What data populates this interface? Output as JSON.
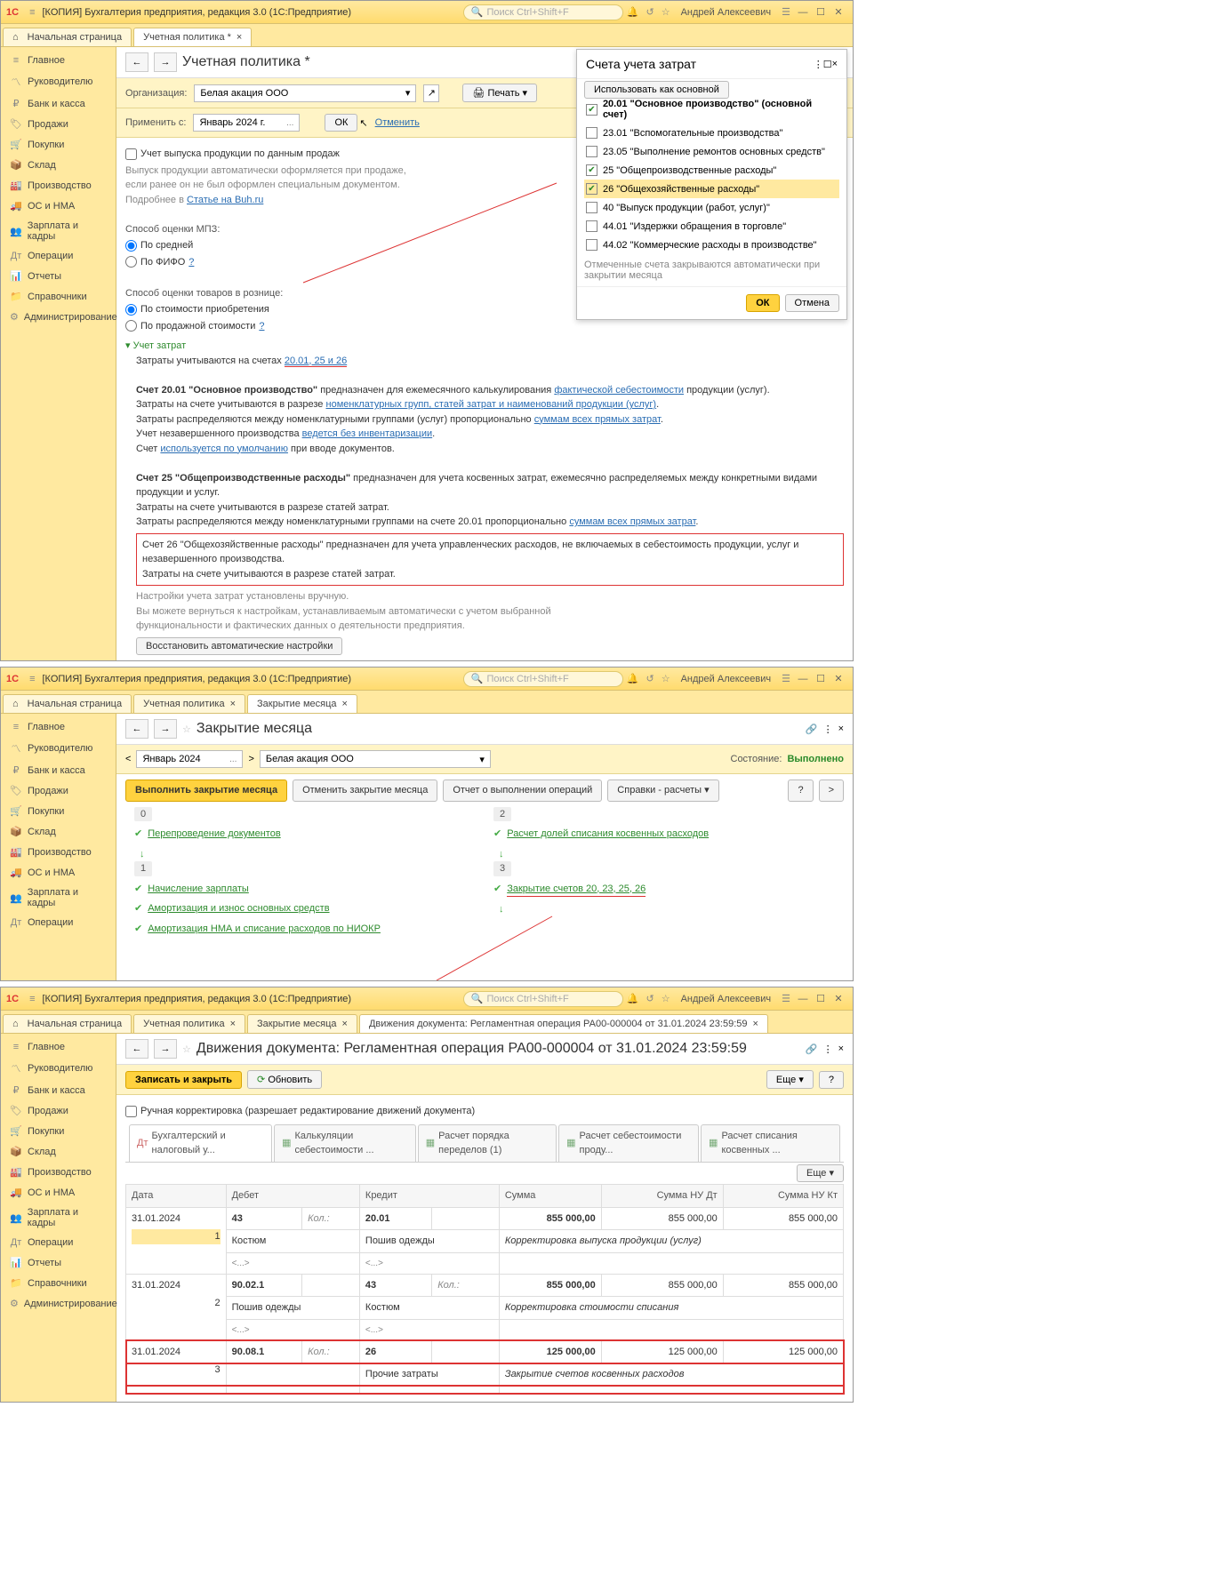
{
  "app1": {
    "title": "[КОПИЯ] Бухгалтерия предприятия, редакция 3.0  (1С:Предприятие)",
    "search_ph": "Поиск Ctrl+Shift+F",
    "user": "Андрей Алексеевич",
    "tab_home": "Начальная страница",
    "tab_policy": "Учетная политика *",
    "sidebar": [
      "Главное",
      "Руководителю",
      "Банк и касса",
      "Продажи",
      "Покупки",
      "Склад",
      "Производство",
      "ОС и НМА",
      "Зарплата и кадры",
      "Операции",
      "Отчеты",
      "Справочники",
      "Администрирование"
    ],
    "page_title": "Учетная политика *",
    "org_lbl": "Организация:",
    "org_val": "Белая акация ООО",
    "print": "Печать",
    "apply_from": "Применить с:",
    "apply_val": "Январь 2024 г.",
    "ok": "ОК",
    "cancel": "Отменить",
    "chk_output": "Учет выпуска продукции по данным продаж",
    "note1": "Выпуск продукции автоматически оформляется при продаже,",
    "note2": "если ранее он не был оформлен специальным документом.",
    "note3": "Подробнее в ",
    "note3l": "Статье на Buh.ru",
    "mpz_lbl": "Способ оценки МПЗ:",
    "mpz1": "По средней",
    "mpz2": "По ФИФО",
    "retail_lbl": "Способ оценки товаров в рознице:",
    "retail1": "По стоимости приобретения",
    "retail2": "По продажной стоимости",
    "q": "?",
    "cost_hdr": "Учет затрат",
    "cost_on": "Затраты учитываются на счетах ",
    "cost_on_l": "20.01, 25 и 26",
    "t2001_a": "Счет 20.01 \"Основное производство\"",
    "t2001_b": " предназначен для ежемесячного калькулирования ",
    "t2001_c": "фактической себестоимости",
    "t2001_d": " продукции (услуг).",
    "l2": "Затраты на счете учитываются в разрезе ",
    "l2l": "номенклатурных групп, статей затрат и наименований продукции (услуг)",
    "l3": "Затраты распределяются между номенклатурными группами (услуг) пропорционально ",
    "l3l": "суммам всех прямых затрат",
    "l4": "Учет незавершенного производства ",
    "l4l": "ведется без инвентаризации",
    "l5": "Счет ",
    "l5l": "используется по умолчанию",
    "l5b": " при вводе документов.",
    "t25a": "Счет 25 \"Общепроизводственные расходы\"",
    "t25b": " предназначен для учета косвенных затрат, ежемесячно распределяемых между конкретными видами продукции и услуг.",
    "t25c": "Затраты на счете учитываются в разрезе статей затрат.",
    "t25d": "Затраты распределяются между номенклатурными группами на счете 20.01 пропорционально ",
    "t25dl": "суммам всех прямых затрат",
    "t26a": "Счет 26 \"Общехозяйственные расходы\" предназначен для учета управленческих расходов, не включаемых в себестоимость продукции, услуг и незавершенного производства.",
    "t26b": "Затраты на счете учитываются в разрезе статей затрат.",
    "man1": "Настройки учета затрат установлены вручную.",
    "man2": "Вы можете вернуться к настройкам, устанавливаемым автоматически с учетом выбранной",
    "man3": "функциональности и фактических данных о деятельности предприятия.",
    "restore": "Восстановить автоматические настройки",
    "popup": {
      "title": "Счета учета затрат",
      "use": "Использовать как основной",
      "items": [
        {
          "c": true,
          "t": "20.01 \"Основное производство\" (основной счет)",
          "b": true
        },
        {
          "c": false,
          "t": "23.01 \"Вспомогательные производства\""
        },
        {
          "c": false,
          "t": "23.05 \"Выполнение ремонтов основных средств\""
        },
        {
          "c": true,
          "t": "25 \"Общепроизводственные расходы\""
        },
        {
          "c": true,
          "t": "26 \"Общехозяйственные расходы\"",
          "sel": true
        },
        {
          "c": false,
          "t": "40 \"Выпуск продукции (работ, услуг)\""
        },
        {
          "c": false,
          "t": "44.01 \"Издержки обращения в торговле\""
        },
        {
          "c": false,
          "t": "44.02 \"Коммерческие расходы в производстве\""
        }
      ],
      "foot_note": "Отмеченные счета закрываются автоматически при закрытии месяца",
      "ok": "ОК",
      "cancel": "Отмена"
    }
  },
  "app2": {
    "title": "[КОПИЯ] Бухгалтерия предприятия, редакция 3.0  (1С:Предприятие)",
    "tab_home": "Начальная страница",
    "tab1": "Учетная политика",
    "tab2": "Закрытие месяца",
    "page_title": "Закрытие месяца",
    "period": "Январь 2024",
    "org": "Белая акация ООО",
    "state_lbl": "Состояние:",
    "state": "Выполнено",
    "run": "Выполнить закрытие месяца",
    "undo": "Отменить закрытие месяца",
    "report": "Отчет о выполнении операций",
    "help": "Справки - расчеты",
    "s0": "0",
    "s0a": "Перепроведение документов",
    "s1": "1",
    "s1a": "Начисление зарплаты",
    "s1b": "Амортизация и износ основных средств",
    "s1c": "Амортизация НМА и списание расходов по НИОКР",
    "s2": "2",
    "s2a": "Расчет долей списания косвенных расходов",
    "s3": "3",
    "s3a": "Закрытие счетов 20, 23, 25, 26"
  },
  "app3": {
    "title": "[КОПИЯ] Бухгалтерия предприятия, редакция 3.0  (1С:Предприятие)",
    "tab_home": "Начальная страница",
    "tab1": "Учетная политика",
    "tab2": "Закрытие месяца",
    "tab3": "Движения документа: Регламентная операция РА00-000004 от 31.01.2024 23:59:59",
    "page_title": "Движения документа: Регламентная операция РА00-000004 от 31.01.2024 23:59:59",
    "save": "Записать и закрыть",
    "refresh": "Обновить",
    "more": "Еще",
    "q": "?",
    "manual": "Ручная корректировка (разрешает редактирование движений документа)",
    "sub": [
      "Бухгалтерский и налоговый у...",
      "Калькуляции себестоимости ...",
      "Расчет порядка переделов (1)",
      "Расчет себестоимости проду...",
      "Расчет списания косвенных ..."
    ],
    "cols": {
      "date": "Дата",
      "debit": "Дебет",
      "credit": "Кредит",
      "sum": "Сумма",
      "sumdt": "Сумма НУ Дт",
      "sumkt": "Сумма НУ Кт"
    },
    "kol": "Кол.:",
    "rows": [
      {
        "n": "1",
        "date": "31.01.2024",
        "d1": "43",
        "d2": "Костюм",
        "d3": "<...>",
        "c1": "20.01",
        "c2": "Пошив одежды",
        "c3": "<...>",
        "desc": "Корректировка выпуска продукции (услуг)",
        "s": "855 000,00",
        "sdt": "855 000,00",
        "skt": "855 000,00",
        "sel": true
      },
      {
        "n": "2",
        "date": "31.01.2024",
        "d1": "90.02.1",
        "d2": "Пошив одежды",
        "d3": "<...>",
        "c1": "43",
        "c2": "Костюм",
        "c3": "<...>",
        "desc": "Корректировка стоимости списания",
        "s": "855 000,00",
        "sdt": "855 000,00",
        "skt": "855 000,00",
        "ckol": true
      },
      {
        "n": "3",
        "date": "31.01.2024",
        "d1": "90.08.1",
        "d2": "",
        "d3": "",
        "c1": "26",
        "c2": "Прочие затраты",
        "c3": "",
        "desc": "Закрытие счетов косвенных расходов",
        "s": "125 000,00",
        "sdt": "125 000,00",
        "skt": "125 000,00",
        "red": true
      }
    ]
  }
}
